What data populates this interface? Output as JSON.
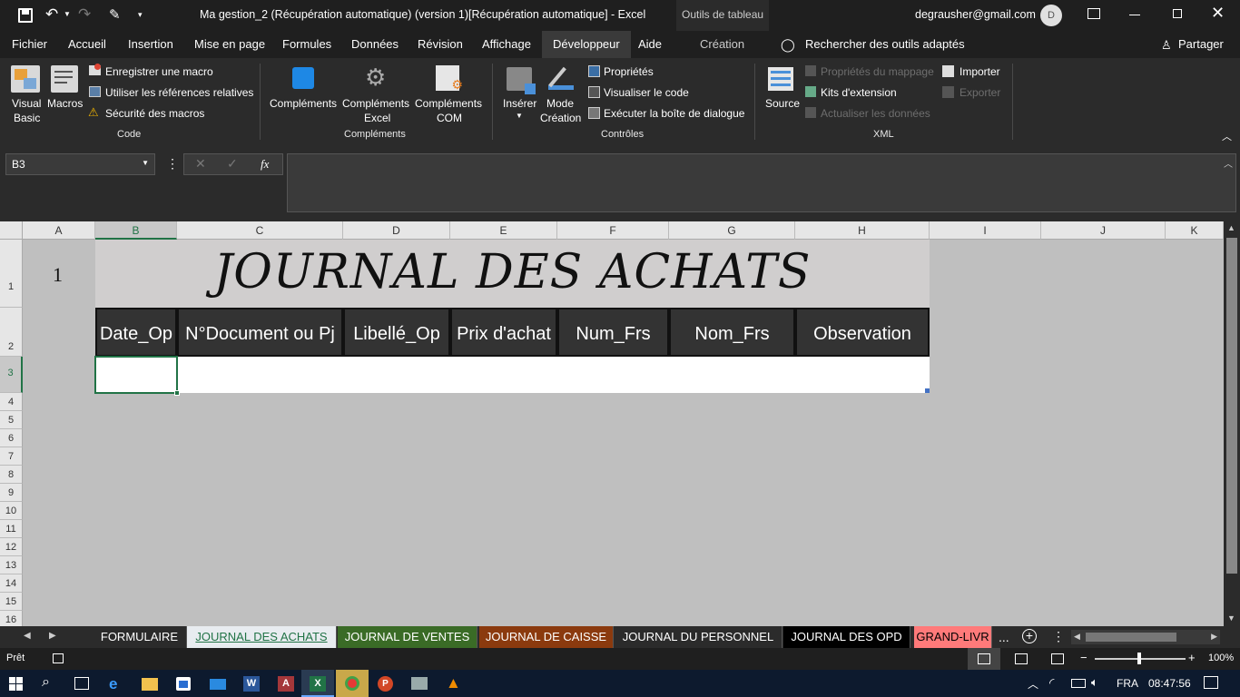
{
  "titlebar": {
    "title": "Ma gestion_2 (Récupération automatique) (version 1)[Récupération automatique]  -  Excel",
    "context_tab": "Outils de tableau",
    "account": "degrausher@gmail.com",
    "avatar": "D"
  },
  "tabs": [
    "Fichier",
    "Accueil",
    "Insertion",
    "Mise en page",
    "Formules",
    "Données",
    "Révision",
    "Affichage",
    "Développeur",
    "Aide",
    "Création"
  ],
  "tell_me": "Rechercher des outils adaptés",
  "share": "Partager",
  "ribbon": {
    "code": {
      "visual_basic_1": "Visual",
      "visual_basic_2": "Basic",
      "macros": "Macros",
      "record": "Enregistrer une macro",
      "relative": "Utiliser les références relatives",
      "security": "Sécurité des macros",
      "group": "Code"
    },
    "addins": {
      "complements": "Compléments",
      "excel_1": "Compléments",
      "excel_2": "Excel",
      "com_1": "Compléments",
      "com_2": "COM",
      "group": "Compléments"
    },
    "controls": {
      "insert": "Insérer",
      "mode_1": "Mode",
      "mode_2": "Création",
      "properties": "Propriétés",
      "view_code": "Visualiser le code",
      "run_dialog": "Exécuter la boîte de dialogue",
      "group": "Contrôles"
    },
    "xml": {
      "source": "Source",
      "map_props": "Propriétés du mappage",
      "expansion": "Kits d'extension",
      "refresh": "Actualiser les données",
      "import": "Importer",
      "export": "Exporter",
      "group": "XML"
    }
  },
  "formula": {
    "namebox": "B3",
    "fx": "fx",
    "content": ""
  },
  "grid": {
    "columns": [
      "A",
      "B",
      "C",
      "D",
      "E",
      "F",
      "G",
      "H",
      "I",
      "J",
      "K"
    ],
    "rows": [
      "1",
      "2",
      "3",
      "4",
      "5",
      "6",
      "7",
      "8",
      "9",
      "10",
      "11",
      "12",
      "13",
      "14",
      "15",
      "16"
    ],
    "a1_value": "1",
    "title": "JOURNAL DES ACHATS",
    "headers": [
      "Date_Op",
      "N°Document ou Pj",
      "Libellé_Op",
      "Prix d'achat",
      "Num_Frs",
      "Nom_Frs",
      "Observation"
    ]
  },
  "sheets": [
    {
      "name": "FORMULAIRE",
      "bg": "#2b2b2b",
      "fg": "#ffffff"
    },
    {
      "name": "JOURNAL DES ACHATS",
      "bg": "#e8ecf0",
      "fg": "#217346"
    },
    {
      "name": "JOURNAL DE VENTES",
      "bg": "#3a6b26",
      "fg": "#ffffff"
    },
    {
      "name": "JOURNAL DE CAISSE",
      "bg": "#8b3a0e",
      "fg": "#ffffff"
    },
    {
      "name": "JOURNAL DU PERSONNEL",
      "bg": "#2b2b2b",
      "fg": "#ffffff"
    },
    {
      "name": "JOURNAL DES OPD",
      "bg": "#000000",
      "fg": "#ffffff"
    },
    {
      "name": "GRAND-LIVR",
      "bg": "#ff7a7a",
      "fg": "#000000"
    }
  ],
  "more": "...",
  "status": {
    "ready": "Prêt",
    "zoom": "100%"
  },
  "taskbar": {
    "lang": "FRA",
    "time": "08:47:56"
  }
}
